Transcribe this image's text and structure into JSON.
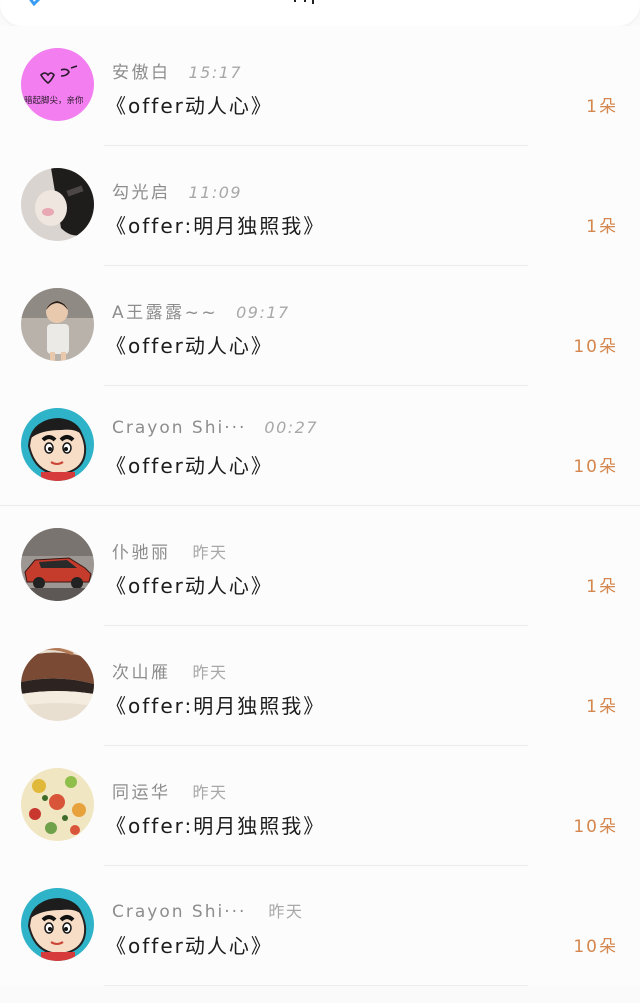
{
  "colors": {
    "count": "#d4874e",
    "name": "#8d8d8d",
    "gift": "#1c1c1c",
    "back": "#3b9cf3"
  },
  "header": {
    "back_icon": "back-arrow-icon"
  },
  "records": [
    {
      "name": "安傲白",
      "time": "15:17",
      "gift": "《offer动人心》",
      "count": "1朵",
      "avatar": "avatar-pink-face"
    },
    {
      "name": "勾光启",
      "time": "11:09",
      "gift": "《offer:明月独照我》",
      "count": "1朵",
      "avatar": "avatar-photo-1"
    },
    {
      "name": "A王露露~~",
      "time": "09:17",
      "gift": "《offer动人心》",
      "count": "10朵",
      "avatar": "avatar-child"
    },
    {
      "name": "Crayon Shi···",
      "time": "00:27",
      "gift": "《offer动人心》",
      "count": "10朵",
      "avatar": "avatar-shinchan"
    },
    {
      "name": "仆驰丽",
      "time": "昨天",
      "gift": "《offer动人心》",
      "count": "1朵",
      "avatar": "avatar-car"
    },
    {
      "name": "次山雁",
      "time": "昨天",
      "gift": "《offer:明月独照我》",
      "count": "1朵",
      "avatar": "avatar-bread"
    },
    {
      "name": "同运华",
      "time": "昨天",
      "gift": "《offer:明月独照我》",
      "count": "10朵",
      "avatar": "avatar-fruit"
    },
    {
      "name": "Crayon Shi···",
      "time": "昨天",
      "gift": "《offer动人心》",
      "count": "10朵",
      "avatar": "avatar-shinchan"
    }
  ],
  "avatar_texts": {
    "pink": "暗起脚尖，亲你"
  }
}
